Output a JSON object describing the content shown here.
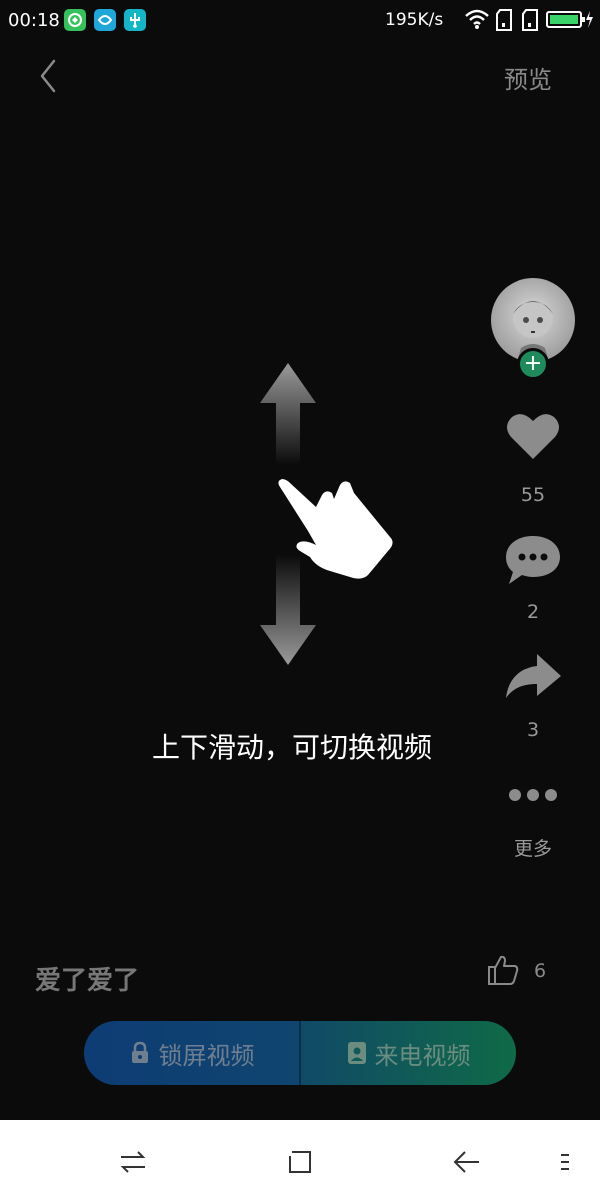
{
  "status": {
    "time": "00:18",
    "speed": "195K/s",
    "icons": [
      "wechat-app-icon",
      "browser-app-icon",
      "usb-icon",
      "wifi-icon",
      "sim1-icon",
      "sim2-icon",
      "battery-icon"
    ]
  },
  "header": {
    "preview_label": "预览"
  },
  "side": {
    "likes": "55",
    "comments": "2",
    "shares": "3",
    "more_label": "更多"
  },
  "overlay": {
    "hint": "上下滑动，可切换视频"
  },
  "video": {
    "title": "爱了爱了",
    "thumbs_count": "6"
  },
  "actions": {
    "lock_label": "锁屏视频",
    "call_label": "来电视频"
  },
  "colors": {
    "background": "#0b0b0c",
    "lock_button": "#0e3c74",
    "call_button": "#0f6a47",
    "follow_plus": "#1f8a5c"
  }
}
